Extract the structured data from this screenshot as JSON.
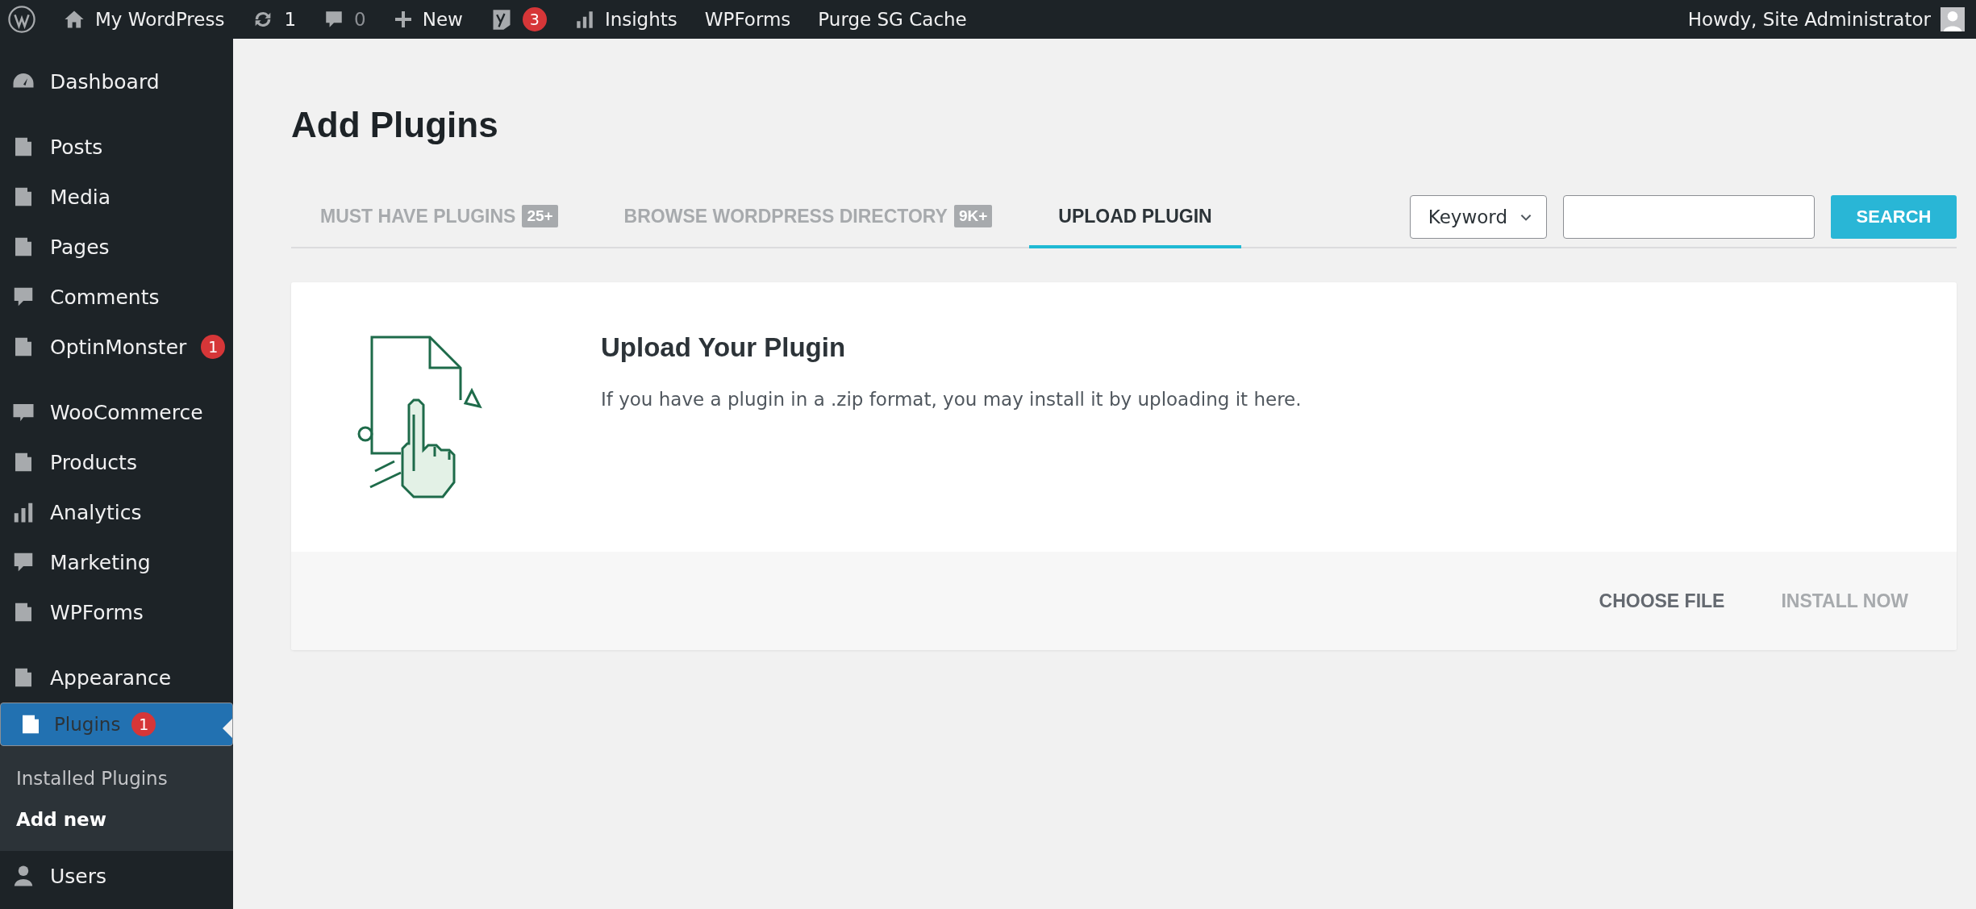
{
  "admin_bar": {
    "site_name": "My WordPress",
    "updates": "1",
    "comments": "0",
    "new": "New",
    "seo_count": "3",
    "insights": "Insights",
    "wpforms": "WPForms",
    "purge": "Purge SG Cache",
    "greeting": "Howdy, Site Administrator"
  },
  "sidebar": {
    "groups": [
      [
        {
          "label": "Dashboard",
          "selected": false
        }
      ],
      [
        {
          "label": "Posts",
          "selected": false
        },
        {
          "label": "Media",
          "selected": false
        },
        {
          "label": "Pages",
          "selected": false
        },
        {
          "label": "Comments",
          "selected": false
        },
        {
          "label": "OptinMonster",
          "selected": false,
          "badge": "1"
        }
      ],
      [
        {
          "label": "WooCommerce",
          "selected": false
        },
        {
          "label": "Products",
          "selected": false
        },
        {
          "label": "Analytics",
          "selected": false
        },
        {
          "label": "Marketing",
          "selected": false
        },
        {
          "label": "WPForms",
          "selected": false
        }
      ],
      [
        {
          "label": "Appearance",
          "selected": false
        },
        {
          "label": "Plugins",
          "selected": true,
          "badge": "1",
          "children": [
            {
              "label": "Installed Plugins",
              "selected": false
            },
            {
              "label": "Add new",
              "selected": true
            }
          ]
        },
        {
          "label": "Users",
          "selected": false
        }
      ]
    ]
  },
  "page": {
    "title": "Add Plugins"
  },
  "tabs": [
    {
      "label": "MUST HAVE PLUGINS",
      "badge": "25+",
      "selected": false
    },
    {
      "label": "BROWSE WORDPRESS DIRECTORY",
      "badge": "9K+",
      "selected": false
    },
    {
      "label": "UPLOAD PLUGIN",
      "selected": true
    }
  ],
  "search": {
    "type": "Keyword",
    "button": "SEARCH"
  },
  "upload": {
    "title": "Upload Your Plugin",
    "text": "If you have a plugin in a .zip format, you may install it by uploading it here.",
    "buttons": [
      {
        "label": "CHOOSE FILE",
        "disabled": false
      },
      {
        "label": "INSTALL NOW",
        "disabled": true
      }
    ]
  }
}
